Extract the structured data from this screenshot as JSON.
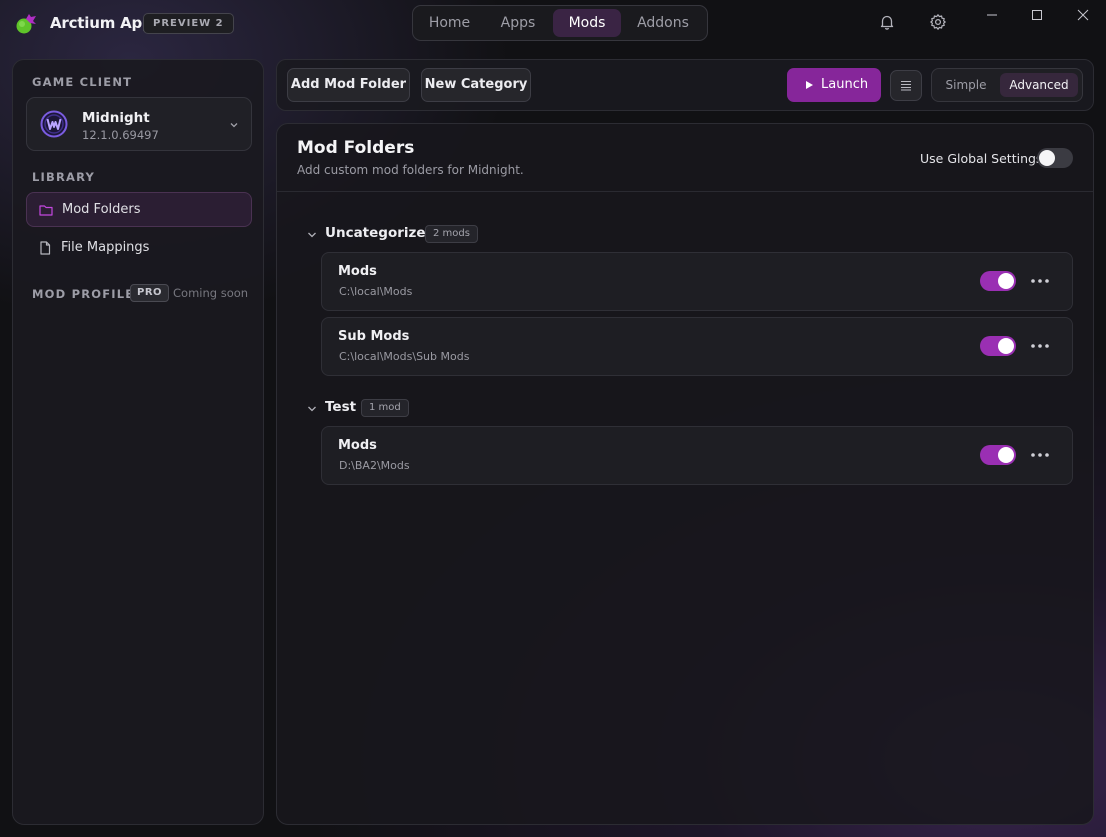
{
  "app": {
    "name": "Arctium App",
    "badge": "PREVIEW 2"
  },
  "topnav": {
    "tabs": [
      {
        "label": "Home",
        "active": false
      },
      {
        "label": "Apps",
        "active": false
      },
      {
        "label": "Mods",
        "active": true
      },
      {
        "label": "Addons",
        "active": false
      }
    ]
  },
  "titlebar": {
    "icons": [
      "bell-icon",
      "gear-icon"
    ],
    "window_controls": [
      "minimize-icon",
      "maximize-icon",
      "close-icon"
    ]
  },
  "sidebar": {
    "game_client_label": "GAME CLIENT",
    "client": {
      "name": "Midnight",
      "version": "12.1.0.69497",
      "icon": "wow-icon"
    },
    "library_label": "LIBRARY",
    "items": [
      {
        "label": "Mod Folders",
        "icon": "folder-icon",
        "active": true
      },
      {
        "label": "File Mappings",
        "icon": "file-icon",
        "active": false
      }
    ],
    "profiles_label": "MOD PROFILES",
    "pro_badge": "PRO",
    "coming_soon": "Coming soon"
  },
  "toolbar": {
    "add_folder": "Add Mod Folder",
    "new_category": "New Category",
    "launch": "Launch",
    "modes": [
      {
        "label": "Simple",
        "active": false
      },
      {
        "label": "Advanced",
        "active": true
      }
    ]
  },
  "panel": {
    "title": "Mod Folders",
    "subtitle": "Add custom mod folders for Midnight.",
    "global_label": "Use Global Settings",
    "global_enabled": false,
    "categories": [
      {
        "name": "Uncategorized",
        "count": "2 mods",
        "mods": [
          {
            "name": "Mods",
            "path": "C:\\local\\Mods",
            "enabled": true
          },
          {
            "name": "Sub Mods",
            "path": "C:\\local\\Mods\\Sub Mods",
            "enabled": true
          }
        ]
      },
      {
        "name": "Test",
        "count": "1 mod",
        "mods": [
          {
            "name": "Mods",
            "path": "D:\\BA2\\Mods",
            "enabled": true
          }
        ]
      }
    ]
  },
  "colors": {
    "accent": "#86269a",
    "toggle_on": "#9a2fb3",
    "background": "#111114"
  }
}
